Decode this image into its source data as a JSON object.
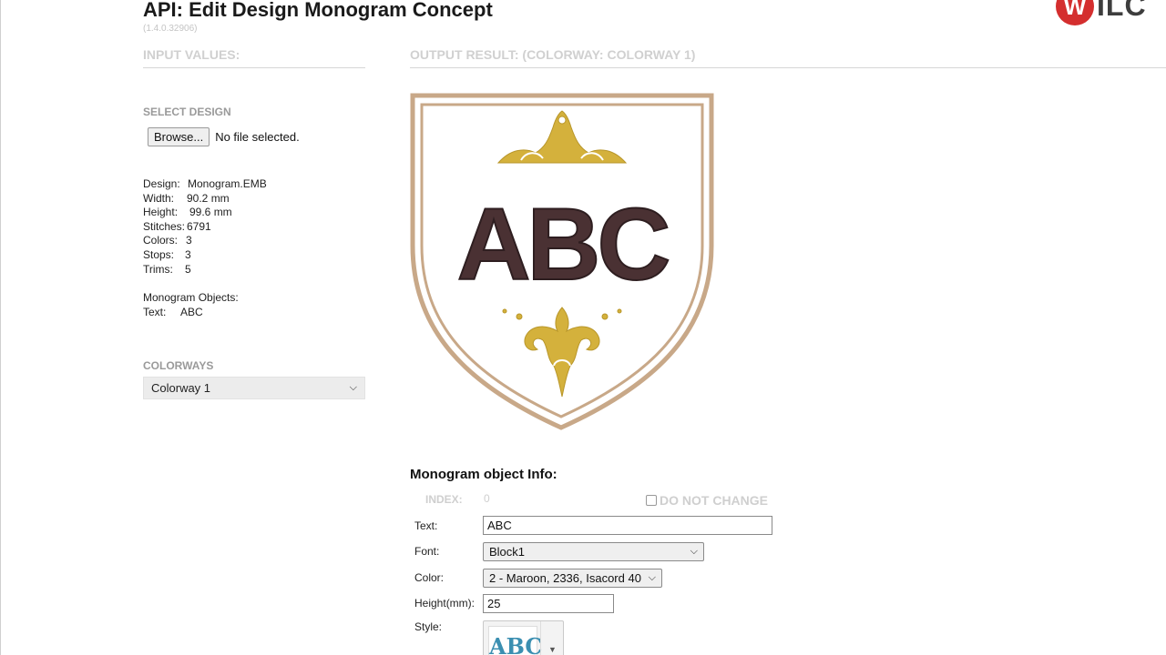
{
  "header": {
    "title": "API: Edit Design Monogram Concept",
    "version": "(1.4.0.32906)",
    "logo": {
      "mark": "W",
      "text": "ILC",
      "accent": "#d42e2e"
    }
  },
  "sections": {
    "input": "INPUT VALUES:",
    "output": "OUTPUT RESULT: (COLORWAY: COLORWAY 1)"
  },
  "select_design": {
    "heading": "SELECT DESIGN",
    "browse_label": "Browse...",
    "file_status": "No file selected."
  },
  "design_info": {
    "design": {
      "label": "Design:",
      "value": "Monogram.EMB"
    },
    "width": {
      "label": "Width:",
      "value": "90.2 mm"
    },
    "height": {
      "label": "Height:",
      "value": "99.6 mm"
    },
    "stitches": {
      "label": "Stitches:",
      "value": "6791"
    },
    "colors": {
      "label": "Colors:",
      "value": "3"
    },
    "stops": {
      "label": "Stops:",
      "value": "3"
    },
    "trims": {
      "label": "Trims:",
      "value": "5"
    }
  },
  "monogram_objects": {
    "heading": "Monogram Objects:",
    "text_label": "Text:",
    "text_value": "ABC"
  },
  "colorways": {
    "heading": "COLORWAYS",
    "selected": "Colorway 1"
  },
  "preview": {
    "monogram_text": "ABC",
    "colors": {
      "thread_maroon": "#4a3133",
      "thread_gold": "#d4b13c",
      "border_tan": "#c8a888"
    }
  },
  "monogram_object_info": {
    "title": "Monogram object Info:",
    "index_label": "INDEX:",
    "index_value": "0",
    "do_not_change_label": "DO NOT CHANGE",
    "text_label": "Text:",
    "text_value": "ABC",
    "font_label": "Font:",
    "font_value": "Block1",
    "color_label": "Color:",
    "color_value": "2 - Maroon, 2336, Isacord 40",
    "height_label": "Height(mm):",
    "height_value": "25",
    "style_label": "Style:",
    "style_thumb_text": "ABC"
  }
}
